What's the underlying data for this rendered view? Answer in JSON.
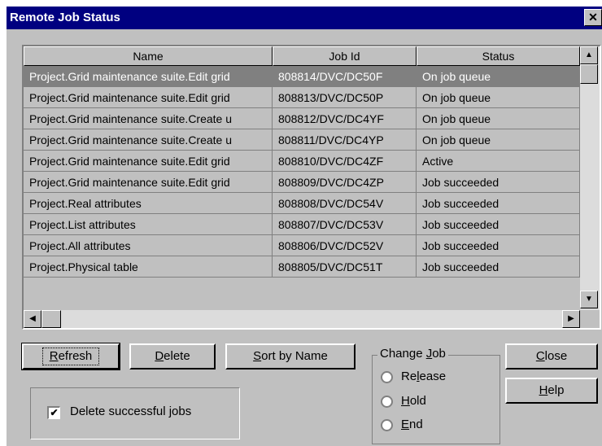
{
  "window": {
    "title": "Remote Job Status",
    "close_glyph": "✕"
  },
  "table": {
    "columns": [
      "Name",
      "Job Id",
      "Status"
    ],
    "rows": [
      {
        "name": "Project.Grid maintenance suite.Edit grid",
        "job_id": "808814/DVC/DC50F",
        "status": "On job queue"
      },
      {
        "name": "Project.Grid maintenance suite.Edit grid",
        "job_id": "808813/DVC/DC50P",
        "status": "On job queue"
      },
      {
        "name": "Project.Grid maintenance suite.Create u",
        "job_id": "808812/DVC/DC4YF",
        "status": "On job queue"
      },
      {
        "name": "Project.Grid maintenance suite.Create u",
        "job_id": "808811/DVC/DC4YP",
        "status": "On job queue"
      },
      {
        "name": "Project.Grid maintenance suite.Edit grid",
        "job_id": "808810/DVC/DC4ZF",
        "status": "Active"
      },
      {
        "name": "Project.Grid maintenance suite.Edit grid",
        "job_id": "808809/DVC/DC4ZP",
        "status": "Job succeeded"
      },
      {
        "name": "Project.Real attributes",
        "job_id": "808808/DVC/DC54V",
        "status": "Job succeeded"
      },
      {
        "name": "Project.List attributes",
        "job_id": "808807/DVC/DC53V",
        "status": "Job succeeded"
      },
      {
        "name": "Project.All attributes",
        "job_id": "808806/DVC/DC52V",
        "status": "Job succeeded"
      },
      {
        "name": "Project.Physical table",
        "job_id": "808805/DVC/DC51T",
        "status": "Job succeeded"
      }
    ],
    "selected_row": 0
  },
  "buttons": {
    "refresh": {
      "mnemonic": "R",
      "rest": "efresh"
    },
    "delete": {
      "mnemonic": "D",
      "rest": "elete"
    },
    "sort": {
      "mnemonic": "S",
      "rest": "ort by Name"
    },
    "close": {
      "mnemonic": "C",
      "rest": "lose"
    },
    "help": {
      "mnemonic": "H",
      "rest": "elp"
    }
  },
  "delete_successful": {
    "label": "Delete successful jobs",
    "checked": true,
    "check_glyph": "✔"
  },
  "change_job": {
    "legend_prefix": "Change ",
    "legend_mnemonic": "J",
    "legend_rest": "ob",
    "release": {
      "pre": "Re",
      "mnemonic": "l",
      "post": "ease"
    },
    "hold": {
      "mnemonic": "H",
      "rest": "old"
    },
    "end": {
      "mnemonic": "E",
      "rest": "nd"
    }
  },
  "icons": {
    "scroll_up": "▲",
    "scroll_down": "▼",
    "scroll_left": "◀",
    "scroll_right": "▶"
  }
}
